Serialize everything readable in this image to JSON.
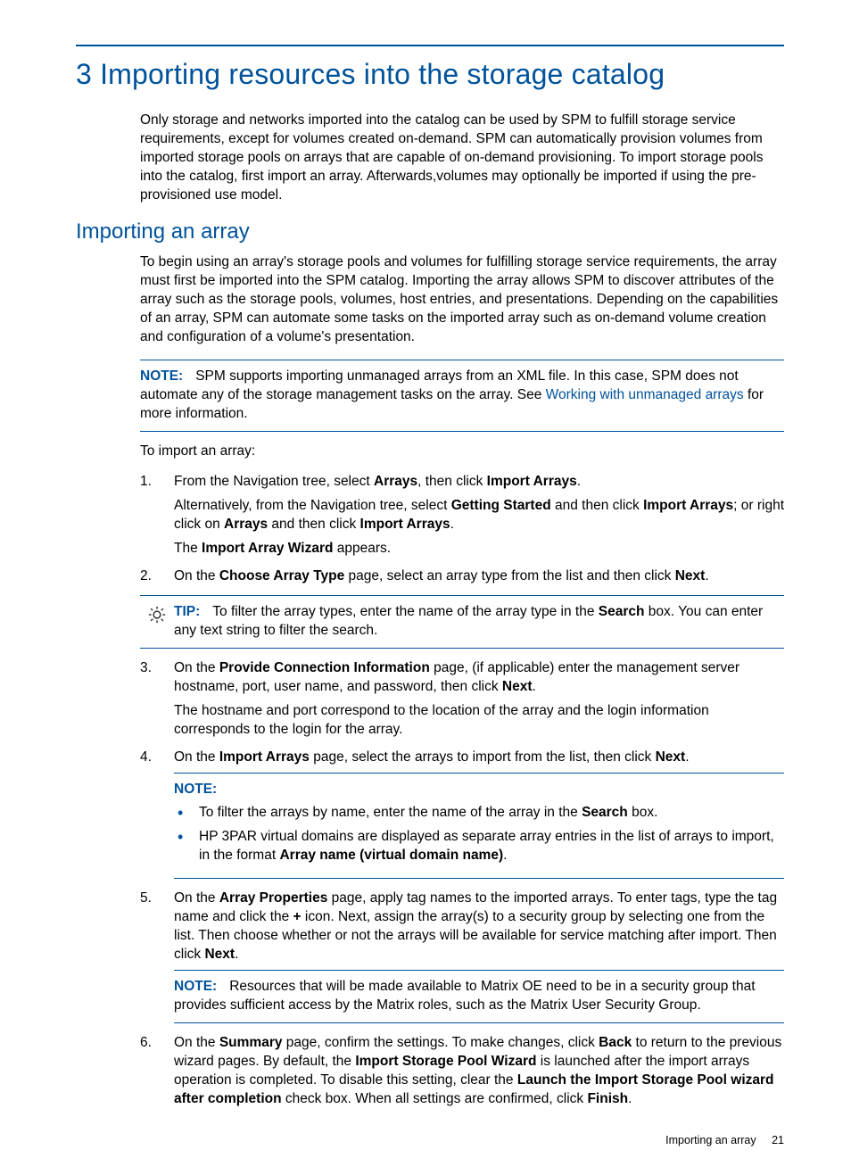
{
  "chapter": {
    "number": "3",
    "title": "Importing resources into the storage catalog",
    "intro": "Only storage and networks imported into the catalog can be used by SPM to fulfill storage service requirements, except for volumes created on-demand. SPM can automatically provision volumes from imported storage pools on arrays that are capable of on-demand provisioning. To import storage pools into the catalog, first import an array. Afterwards,volumes may optionally be imported if using the pre-provisioned use model."
  },
  "section": {
    "title": "Importing an array",
    "intro": "To begin using an array's storage pools and volumes for fulfilling storage service requirements, the array must first be imported into the SPM catalog. Importing the array allows SPM to discover attributes of the array such as the storage pools, volumes, host entries, and presentations. Depending on the capabilities of an array, SPM can automate some tasks on the imported array such as on-demand volume creation and configuration of a volume's presentation.",
    "note1": {
      "label": "NOTE:",
      "pre": "SPM supports importing unmanaged arrays from an XML file. In this case, SPM does not automate any of the storage management tasks on the array. See ",
      "link": "Working with unmanaged arrays",
      "post": " for more information."
    },
    "lead": "To import an array:",
    "step1": {
      "a1": "From the Navigation tree, select ",
      "b1": "Arrays",
      "a2": ", then click ",
      "b2": "Import Arrays",
      "a3": ".",
      "alt_a1": "Alternatively, from the Navigation tree, select ",
      "alt_b1": "Getting Started",
      "alt_a2": " and then click ",
      "alt_b2": "Import Arrays",
      "alt_a3": "; or right click on ",
      "alt_b3": "Arrays",
      "alt_a4": " and then click ",
      "alt_b4": "Import Arrays",
      "alt_a5": ".",
      "res_a1": "The ",
      "res_b1": "Import Array Wizard",
      "res_a2": " appears."
    },
    "step2": {
      "a1": "On the ",
      "b1": "Choose Array Type",
      "a2": " page, select an array type from the list and then click ",
      "b2": "Next",
      "a3": "."
    },
    "tip": {
      "label": "TIP:",
      "a1": "To filter the array types, enter the name of the array type in the ",
      "b1": "Search",
      "a2": " box. You can enter any text string to filter the search."
    },
    "step3": {
      "a1": "On the ",
      "b1": "Provide Connection Information",
      "a2": " page, (if applicable) enter the management server hostname, port, user name, and password, then click ",
      "b2": "Next",
      "a3": ".",
      "sub": "The hostname and port correspond to the location of the array and the login information corresponds to the login for the array."
    },
    "step4": {
      "a1": "On the ",
      "b1": "Import Arrays",
      "a2": " page, select the arrays to import from the list, then click ",
      "b2": "Next",
      "a3": ".",
      "note_label": "NOTE:",
      "bul1_a1": "To filter the arrays by name, enter the name of the array in the ",
      "bul1_b1": "Search",
      "bul1_a2": " box.",
      "bul2_a1": "HP 3PAR virtual domains are displayed as separate array entries in the list of arrays to import, in the format ",
      "bul2_b1": "Array name (virtual domain name)",
      "bul2_a2": "."
    },
    "step5": {
      "a1": "On the ",
      "b1": "Array Properties",
      "a2": " page, apply tag names to the imported arrays. To enter tags, type the tag name and click the ",
      "b2": "+",
      "a3": " icon. Next, assign the array(s) to a security group by selecting one from the list. Then choose whether or not the arrays will be available for service matching after import. Then click ",
      "b3": "Next",
      "a4": ".",
      "note_label": "NOTE:",
      "note_text": "Resources that will be made available to Matrix OE need to be in a security group that provides sufficient access by the Matrix roles, such as the Matrix User Security Group."
    },
    "step6": {
      "a1": "On the ",
      "b1": "Summary",
      "a2": " page, confirm the settings. To make changes, click ",
      "b2": "Back",
      "a3": " to return to the previous wizard pages. By default, the ",
      "b3": "Import Storage Pool Wizard",
      "a4": " is launched after the import arrays operation is completed. To disable this setting, clear the ",
      "b4": "Launch the Import Storage Pool wizard after completion",
      "a5": " check box. When all settings are confirmed, click ",
      "b5": "Finish",
      "a6": "."
    }
  },
  "footer": {
    "text": "Importing an array",
    "page": "21"
  }
}
